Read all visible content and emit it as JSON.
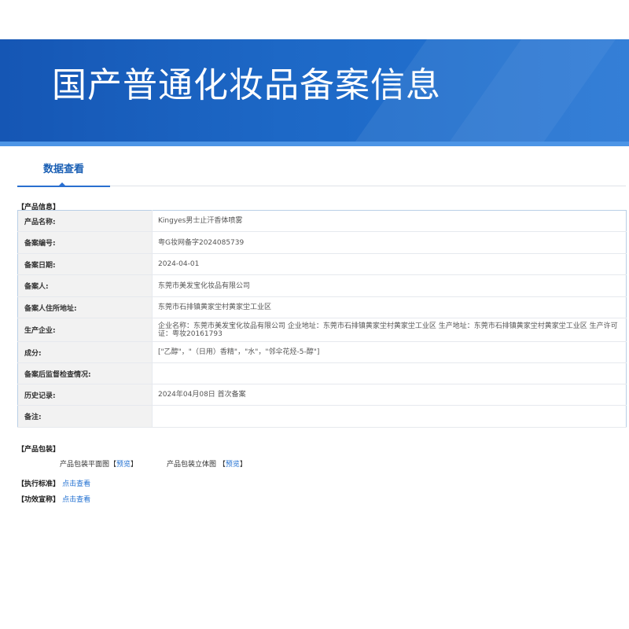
{
  "header": {
    "title": "国产普通化妆品备案信息"
  },
  "tabs": [
    {
      "label": "数据查看"
    }
  ],
  "product_info": {
    "section_title": "【产品信息】",
    "rows": [
      {
        "label": "产品名称:",
        "value": "Kingyes男士止汗香体喷雾"
      },
      {
        "label": "备案编号:",
        "value": "粤G妆网备字2024085739"
      },
      {
        "label": "备案日期:",
        "value": "2024-04-01"
      },
      {
        "label": "备案人:",
        "value": "东莞市美发宝化妆品有限公司"
      },
      {
        "label": "备案人住所地址:",
        "value": "东莞市石排镇黄家坣村黄家坣工业区"
      },
      {
        "label": "生产企业:",
        "value": "企业名称：东莞市美发宝化妆品有限公司 企业地址：东莞市石排镇黄家坣村黄家坣工业区 生产地址：东莞市石排镇黄家坣村黄家坣工业区 生产许可证：粤妆20161793"
      },
      {
        "label": "成分:",
        "value": "[\"乙醇\"，\"（日用）香精\"，\"水\"，\"邻伞花烃-5-醇\"]"
      },
      {
        "label": "备案后监督检查情况:",
        "value": ""
      },
      {
        "label": "历史记录:",
        "value": "2024年04月08日 首次备案"
      },
      {
        "label": "备注:",
        "value": ""
      }
    ]
  },
  "packaging": {
    "section_title": "【产品包装】",
    "flat_label": "产品包装平面图",
    "flat_link": "预览",
    "solid_label": "产品包装立体图",
    "solid_link": "预览",
    "bracket_open": "【",
    "bracket_close": "】"
  },
  "standard": {
    "label": "【执行标准】",
    "link": "点击查看"
  },
  "efficacy": {
    "label": "【功效宣称】",
    "link": "点击查看"
  },
  "colors": {
    "banner": "#1d68c6",
    "accent": "#1f6fd1",
    "table_border": "#b9cfe6"
  }
}
